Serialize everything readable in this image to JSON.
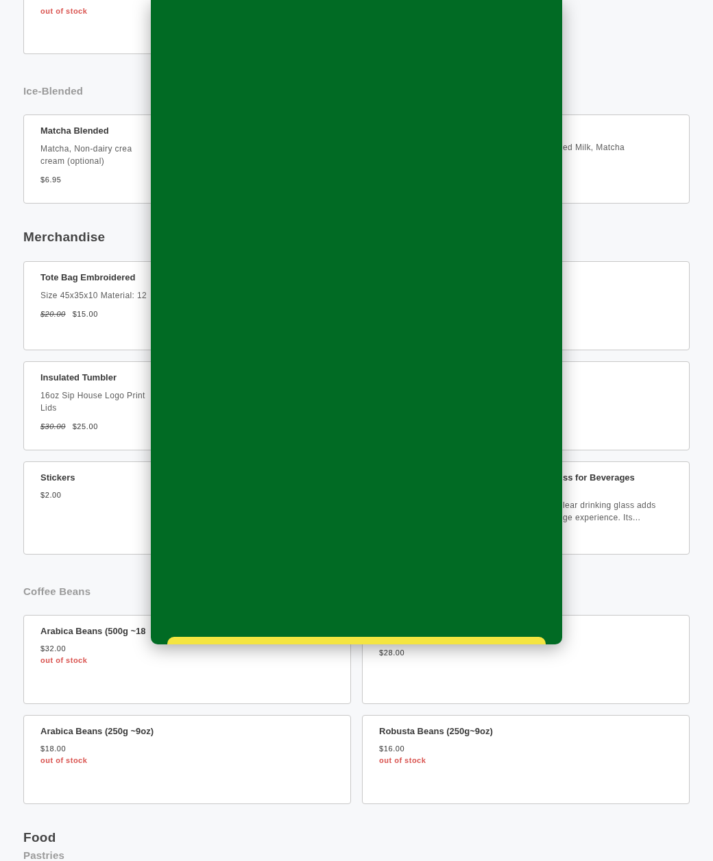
{
  "sections": [
    {
      "kind": "cards",
      "cards": [
        {
          "kind": "partial",
          "stock": "out of stock"
        }
      ]
    },
    {
      "kind": "subheading",
      "title": "Ice-Blended"
    },
    {
      "kind": "cards",
      "cards": [
        {
          "kind": "product",
          "name": "Matcha Blended",
          "description": "Matcha, Non-dairy crea\ncream (optional)",
          "price": "$6.95"
        },
        {
          "kind": "product",
          "cut_at_start": true,
          "description": "ed Milk, Matcha"
        }
      ]
    },
    {
      "kind": "heading",
      "title": "Merchandise"
    },
    {
      "kind": "cards",
      "cards": [
        {
          "kind": "product",
          "name": "Tote Bag Embroidered",
          "description": "Size 45x35x10 Material: 12",
          "original_price": "$20.00",
          "price": "$15.00"
        },
        {
          "kind": "product"
        },
        {
          "kind": "product",
          "name": "Insulated Tumbler",
          "description": "16oz Sip House Logo Print\nLids",
          "original_price": "$30.00",
          "price": "$25.00"
        },
        {
          "kind": "product"
        },
        {
          "kind": "product",
          "name": "Stickers",
          "price": "$2.00"
        },
        {
          "kind": "product",
          "cut_at_start": true,
          "name": "ss for Beverages",
          "description": "lear drinking glass adds\nge experience. Its..."
        }
      ]
    },
    {
      "kind": "subheading",
      "title": "Coffee Beans"
    },
    {
      "kind": "cards",
      "cards": [
        {
          "kind": "product",
          "name": "Arabica Beans (500g ~18",
          "price": "$32.00",
          "stock": "out of stock"
        },
        {
          "kind": "product",
          "price": "$28.00"
        },
        {
          "kind": "product",
          "name": "Arabica Beans (250g ~9oz)",
          "price": "$18.00",
          "stock": "out of stock"
        },
        {
          "kind": "product",
          "name": "Robusta Beans (250g~9oz)",
          "price": "$16.00",
          "stock": "out of stock"
        }
      ]
    },
    {
      "kind": "heading",
      "title": "Food"
    },
    {
      "kind": "subheading",
      "title": "Pastries"
    }
  ]
}
